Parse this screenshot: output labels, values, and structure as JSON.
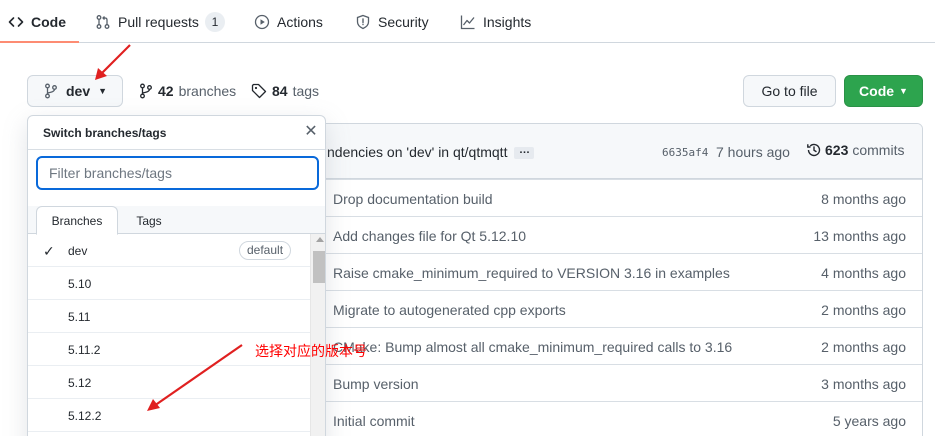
{
  "nav": {
    "tabs": [
      {
        "label": "Code",
        "icon": "code-icon",
        "active": true
      },
      {
        "label": "Pull requests",
        "icon": "pull-request-icon",
        "count": "1"
      },
      {
        "label": "Actions",
        "icon": "play-icon"
      },
      {
        "label": "Security",
        "icon": "shield-icon"
      },
      {
        "label": "Insights",
        "icon": "graph-icon"
      }
    ]
  },
  "branch": {
    "current": "dev",
    "branches_count": "42",
    "branches_label": "branches",
    "tags_count": "84",
    "tags_label": "tags"
  },
  "actions": {
    "go_to_file": "Go to file",
    "code": "Code"
  },
  "commit_header": {
    "message": "ndencies on 'dev' in qt/qtmqtt",
    "ellipsis": "…",
    "sha": "6635af4",
    "time": "7 hours ago",
    "commits_count": "623",
    "commits_label": "commits"
  },
  "files": [
    {
      "message": "Drop documentation build",
      "age": "8 months ago"
    },
    {
      "message": "Add changes file for Qt 5.12.10",
      "age": "13 months ago"
    },
    {
      "message": "Raise cmake_minimum_required to VERSION 3.16 in examples",
      "age": "4 months ago"
    },
    {
      "message": "Migrate to autogenerated cpp exports",
      "age": "2 months ago"
    },
    {
      "message": "CMake: Bump almost all cmake_minimum_required calls to 3.16",
      "age": "2 months ago"
    },
    {
      "message": "Bump version",
      "age": "3 months ago"
    },
    {
      "message": "Initial commit",
      "age": "5 years ago"
    }
  ],
  "dropdown": {
    "title": "Switch branches/tags",
    "filter_placeholder": "Filter branches/tags",
    "tab_branches": "Branches",
    "tab_tags": "Tags",
    "items": [
      {
        "name": "dev",
        "selected": true,
        "badge": "default"
      },
      {
        "name": "5.10"
      },
      {
        "name": "5.11"
      },
      {
        "name": "5.11.2"
      },
      {
        "name": "5.12"
      },
      {
        "name": "5.12.2"
      }
    ]
  },
  "annotation": {
    "text": "选择对应的版本号",
    "color": "#ff0000"
  },
  "colors": {
    "accent": "#0969da",
    "code_button": "#2da44e",
    "tab_underline": "#fd8c73"
  }
}
